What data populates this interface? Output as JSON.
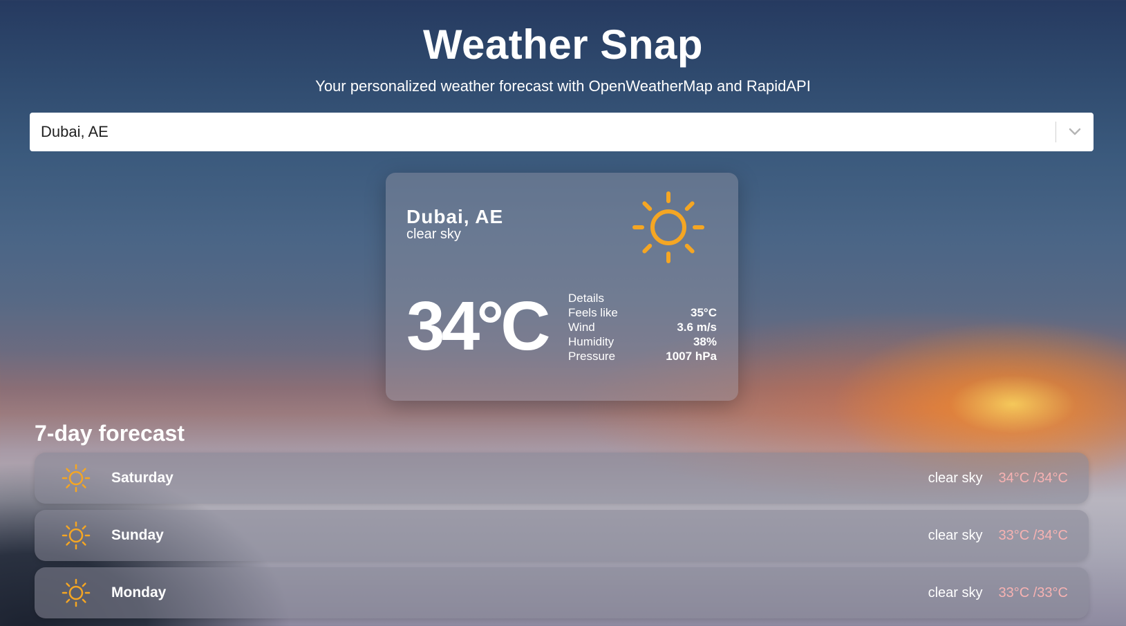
{
  "header": {
    "title": "Weather Snap",
    "subtitle": "Your personalized weather forecast with OpenWeatherMap and RapidAPI"
  },
  "search": {
    "value": "Dubai, AE",
    "icon": "chevron-down-icon"
  },
  "current": {
    "city": "Dubai, AE",
    "description": "clear sky",
    "icon": "sun-icon",
    "temperature": "34°C",
    "details_label": "Details",
    "details": [
      {
        "label": "Feels like",
        "value": "35°C"
      },
      {
        "label": "Wind",
        "value": "3.6 m/s"
      },
      {
        "label": "Humidity",
        "value": "38%"
      },
      {
        "label": "Pressure",
        "value": "1007 hPa"
      }
    ]
  },
  "forecast": {
    "title": "7-day forecast",
    "items": [
      {
        "day": "Saturday",
        "description": "clear sky",
        "temp": "34°C /34°C",
        "icon": "sun-icon"
      },
      {
        "day": "Sunday",
        "description": "clear sky",
        "temp": "33°C /34°C",
        "icon": "sun-icon"
      },
      {
        "day": "Monday",
        "description": "clear sky",
        "temp": "33°C /33°C",
        "icon": "sun-icon"
      }
    ]
  },
  "colors": {
    "sun": "#f5a623",
    "forecast_temp": "#f7b2b2"
  }
}
